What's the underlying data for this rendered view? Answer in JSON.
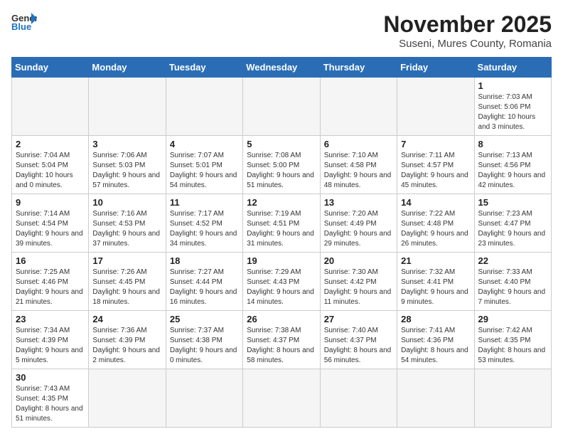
{
  "header": {
    "logo_general": "General",
    "logo_blue": "Blue",
    "month_title": "November 2025",
    "location": "Suseni, Mures County, Romania"
  },
  "days_of_week": [
    "Sunday",
    "Monday",
    "Tuesday",
    "Wednesday",
    "Thursday",
    "Friday",
    "Saturday"
  ],
  "weeks": [
    [
      {
        "day": "",
        "info": ""
      },
      {
        "day": "",
        "info": ""
      },
      {
        "day": "",
        "info": ""
      },
      {
        "day": "",
        "info": ""
      },
      {
        "day": "",
        "info": ""
      },
      {
        "day": "",
        "info": ""
      },
      {
        "day": "1",
        "info": "Sunrise: 7:03 AM\nSunset: 5:06 PM\nDaylight: 10 hours and 3 minutes."
      }
    ],
    [
      {
        "day": "2",
        "info": "Sunrise: 7:04 AM\nSunset: 5:04 PM\nDaylight: 10 hours and 0 minutes."
      },
      {
        "day": "3",
        "info": "Sunrise: 7:06 AM\nSunset: 5:03 PM\nDaylight: 9 hours and 57 minutes."
      },
      {
        "day": "4",
        "info": "Sunrise: 7:07 AM\nSunset: 5:01 PM\nDaylight: 9 hours and 54 minutes."
      },
      {
        "day": "5",
        "info": "Sunrise: 7:08 AM\nSunset: 5:00 PM\nDaylight: 9 hours and 51 minutes."
      },
      {
        "day": "6",
        "info": "Sunrise: 7:10 AM\nSunset: 4:58 PM\nDaylight: 9 hours and 48 minutes."
      },
      {
        "day": "7",
        "info": "Sunrise: 7:11 AM\nSunset: 4:57 PM\nDaylight: 9 hours and 45 minutes."
      },
      {
        "day": "8",
        "info": "Sunrise: 7:13 AM\nSunset: 4:56 PM\nDaylight: 9 hours and 42 minutes."
      }
    ],
    [
      {
        "day": "9",
        "info": "Sunrise: 7:14 AM\nSunset: 4:54 PM\nDaylight: 9 hours and 39 minutes."
      },
      {
        "day": "10",
        "info": "Sunrise: 7:16 AM\nSunset: 4:53 PM\nDaylight: 9 hours and 37 minutes."
      },
      {
        "day": "11",
        "info": "Sunrise: 7:17 AM\nSunset: 4:52 PM\nDaylight: 9 hours and 34 minutes."
      },
      {
        "day": "12",
        "info": "Sunrise: 7:19 AM\nSunset: 4:51 PM\nDaylight: 9 hours and 31 minutes."
      },
      {
        "day": "13",
        "info": "Sunrise: 7:20 AM\nSunset: 4:49 PM\nDaylight: 9 hours and 29 minutes."
      },
      {
        "day": "14",
        "info": "Sunrise: 7:22 AM\nSunset: 4:48 PM\nDaylight: 9 hours and 26 minutes."
      },
      {
        "day": "15",
        "info": "Sunrise: 7:23 AM\nSunset: 4:47 PM\nDaylight: 9 hours and 23 minutes."
      }
    ],
    [
      {
        "day": "16",
        "info": "Sunrise: 7:25 AM\nSunset: 4:46 PM\nDaylight: 9 hours and 21 minutes."
      },
      {
        "day": "17",
        "info": "Sunrise: 7:26 AM\nSunset: 4:45 PM\nDaylight: 9 hours and 18 minutes."
      },
      {
        "day": "18",
        "info": "Sunrise: 7:27 AM\nSunset: 4:44 PM\nDaylight: 9 hours and 16 minutes."
      },
      {
        "day": "19",
        "info": "Sunrise: 7:29 AM\nSunset: 4:43 PM\nDaylight: 9 hours and 14 minutes."
      },
      {
        "day": "20",
        "info": "Sunrise: 7:30 AM\nSunset: 4:42 PM\nDaylight: 9 hours and 11 minutes."
      },
      {
        "day": "21",
        "info": "Sunrise: 7:32 AM\nSunset: 4:41 PM\nDaylight: 9 hours and 9 minutes."
      },
      {
        "day": "22",
        "info": "Sunrise: 7:33 AM\nSunset: 4:40 PM\nDaylight: 9 hours and 7 minutes."
      }
    ],
    [
      {
        "day": "23",
        "info": "Sunrise: 7:34 AM\nSunset: 4:39 PM\nDaylight: 9 hours and 5 minutes."
      },
      {
        "day": "24",
        "info": "Sunrise: 7:36 AM\nSunset: 4:39 PM\nDaylight: 9 hours and 2 minutes."
      },
      {
        "day": "25",
        "info": "Sunrise: 7:37 AM\nSunset: 4:38 PM\nDaylight: 9 hours and 0 minutes."
      },
      {
        "day": "26",
        "info": "Sunrise: 7:38 AM\nSunset: 4:37 PM\nDaylight: 8 hours and 58 minutes."
      },
      {
        "day": "27",
        "info": "Sunrise: 7:40 AM\nSunset: 4:37 PM\nDaylight: 8 hours and 56 minutes."
      },
      {
        "day": "28",
        "info": "Sunrise: 7:41 AM\nSunset: 4:36 PM\nDaylight: 8 hours and 54 minutes."
      },
      {
        "day": "29",
        "info": "Sunrise: 7:42 AM\nSunset: 4:35 PM\nDaylight: 8 hours and 53 minutes."
      }
    ],
    [
      {
        "day": "30",
        "info": "Sunrise: 7:43 AM\nSunset: 4:35 PM\nDaylight: 8 hours and 51 minutes."
      },
      {
        "day": "",
        "info": ""
      },
      {
        "day": "",
        "info": ""
      },
      {
        "day": "",
        "info": ""
      },
      {
        "day": "",
        "info": ""
      },
      {
        "day": "",
        "info": ""
      },
      {
        "day": "",
        "info": ""
      }
    ]
  ]
}
